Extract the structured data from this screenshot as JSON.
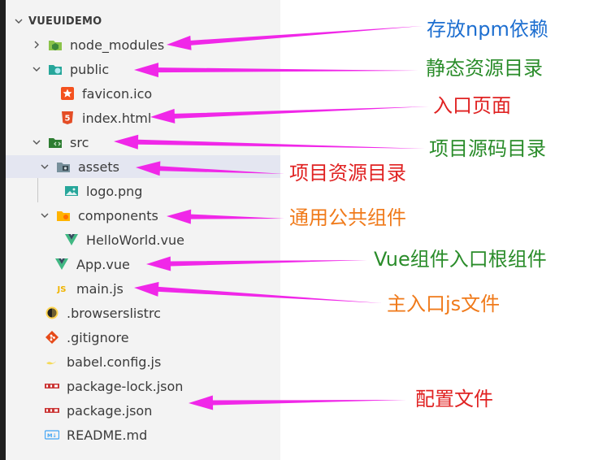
{
  "explorer": {
    "root": "VUEUIDEMO",
    "items": [
      {
        "label": "node_modules",
        "icon": "node-modules-folder-icon",
        "chevron": "right"
      },
      {
        "label": "public",
        "icon": "public-folder-icon",
        "chevron": "down"
      },
      {
        "label": "favicon.ico",
        "icon": "favicon-icon"
      },
      {
        "label": "index.html",
        "icon": "html5-icon"
      },
      {
        "label": "src",
        "icon": "src-folder-icon",
        "chevron": "down"
      },
      {
        "label": "assets",
        "icon": "assets-folder-icon",
        "chevron": "down",
        "selected": true
      },
      {
        "label": "logo.png",
        "icon": "image-icon"
      },
      {
        "label": "components",
        "icon": "components-folder-icon",
        "chevron": "down"
      },
      {
        "label": "HelloWorld.vue",
        "icon": "vue-icon"
      },
      {
        "label": "App.vue",
        "icon": "vue-icon"
      },
      {
        "label": "main.js",
        "icon": "js-icon"
      },
      {
        "label": ".browserslistrc",
        "icon": "browserslist-icon"
      },
      {
        "label": ".gitignore",
        "icon": "git-icon"
      },
      {
        "label": "babel.config.js",
        "icon": "babel-icon"
      },
      {
        "label": "package-lock.json",
        "icon": "npm-icon"
      },
      {
        "label": "package.json",
        "icon": "npm-icon"
      },
      {
        "label": "README.md",
        "icon": "markdown-icon"
      }
    ]
  },
  "annotations": [
    {
      "text": "存放npm依赖",
      "color": "#1e6fd0"
    },
    {
      "text": "静态资源目录",
      "color": "#2a8c2a"
    },
    {
      "text": "入口页面",
      "color": "#e02222"
    },
    {
      "text": "项目源码目录",
      "color": "#2a8c2a"
    },
    {
      "text": "项目资源目录",
      "color": "#e02222"
    },
    {
      "text": "通用公共组件",
      "color": "#f07a1a"
    },
    {
      "text": "Vue组件入口根组件",
      "color": "#2a8c2a"
    },
    {
      "text": "主入口js文件",
      "color": "#f07a1a"
    },
    {
      "text": "配置文件",
      "color": "#e02222"
    }
  ],
  "arrow_color": "#f027e8"
}
